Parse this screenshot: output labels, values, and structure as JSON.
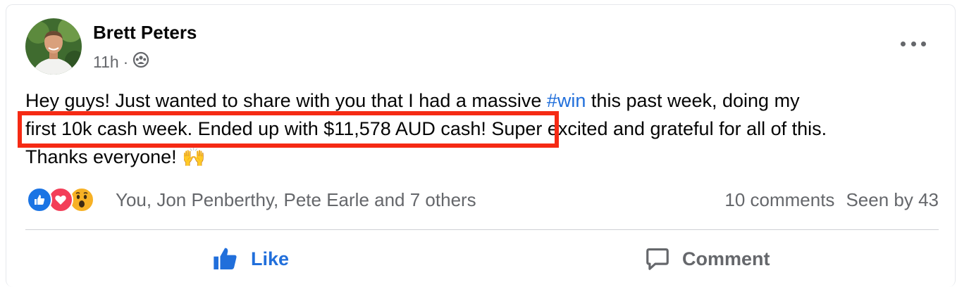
{
  "post": {
    "author": "Brett Peters",
    "time": "11h",
    "separator": "·",
    "audience_icon": "group-icon",
    "more_icon": "more-options-icon",
    "text": {
      "line1_a": "Hey guys! Just wanted to share with you that I had a massive ",
      "hashtag": "#win",
      "line1_b": " this past week, doing my",
      "line2": "first 10k cash week. Ended up with $11,578 AUD cash! Super excited and grateful for all of this.",
      "line3": "Thanks everyone! ",
      "emoji": "🙌"
    },
    "highlight_color": "#f52a14"
  },
  "reactions": {
    "icons": [
      "like-reaction-icon",
      "love-reaction-icon",
      "wow-reaction-icon"
    ],
    "names": "You, Jon Penberthy, Pete Earle and 7 others",
    "comments": "10 comments",
    "seen": "Seen by 43"
  },
  "actions": {
    "like_label": "Like",
    "comment_label": "Comment",
    "like_color": "#216fdb"
  }
}
